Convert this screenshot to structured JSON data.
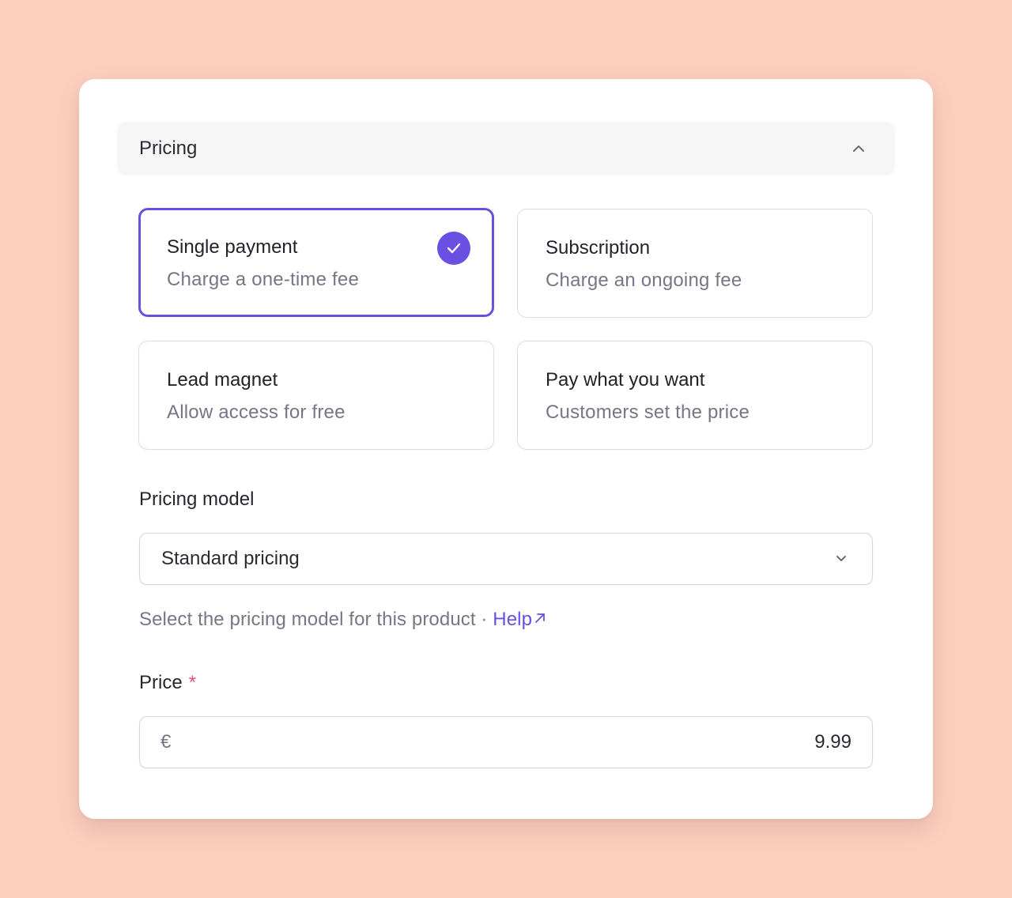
{
  "section": {
    "title": "Pricing",
    "toggle_icon": "chevron-up-icon"
  },
  "options": [
    {
      "title": "Single payment",
      "description": "Charge a one-time fee",
      "selected": true
    },
    {
      "title": "Subscription",
      "description": "Charge an ongoing fee",
      "selected": false
    },
    {
      "title": "Lead magnet",
      "description": "Allow access for free",
      "selected": false
    },
    {
      "title": "Pay what you want",
      "description": "Customers set the price",
      "selected": false
    }
  ],
  "pricing_model": {
    "label": "Pricing model",
    "value": "Standard pricing",
    "hint": "Select the pricing model for this product · ",
    "help_label": "Help"
  },
  "price": {
    "label": "Price",
    "required_marker": "*",
    "currency": "€",
    "value": "9.99"
  },
  "colors": {
    "background": "#fdcdbd",
    "accent": "#6a4fe3",
    "required": "#e05577"
  }
}
